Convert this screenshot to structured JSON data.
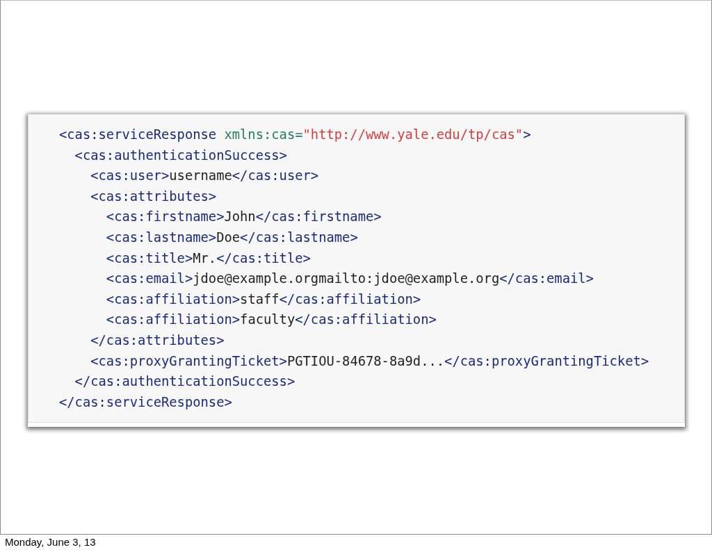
{
  "code_block": {
    "lines": [
      [
        {
          "kind": "tag",
          "text": "<cas:serviceResponse "
        },
        {
          "kind": "attr",
          "text": "xmlns:cas="
        },
        {
          "kind": "string",
          "text": "\"http://www.yale.edu/tp/cas\""
        },
        {
          "kind": "tag",
          "text": ">"
        }
      ],
      [
        {
          "kind": "tag",
          "text": "  <cas:authenticationSuccess>"
        }
      ],
      [
        {
          "kind": "tag",
          "text": "    <cas:user>"
        },
        {
          "kind": "text",
          "text": "username"
        },
        {
          "kind": "tag",
          "text": "</cas:user>"
        }
      ],
      [
        {
          "kind": "tag",
          "text": "    <cas:attributes>"
        }
      ],
      [
        {
          "kind": "tag",
          "text": "      <cas:firstname>"
        },
        {
          "kind": "text",
          "text": "John"
        },
        {
          "kind": "tag",
          "text": "</cas:firstname>"
        }
      ],
      [
        {
          "kind": "tag",
          "text": "      <cas:lastname>"
        },
        {
          "kind": "text",
          "text": "Doe"
        },
        {
          "kind": "tag",
          "text": "</cas:lastname>"
        }
      ],
      [
        {
          "kind": "tag",
          "text": "      <cas:title>"
        },
        {
          "kind": "text",
          "text": "Mr."
        },
        {
          "kind": "tag",
          "text": "</cas:title>"
        }
      ],
      [
        {
          "kind": "tag",
          "text": "      <cas:email>"
        },
        {
          "kind": "text",
          "text": "jdoe@example.orgmailto:jdoe@example.org"
        },
        {
          "kind": "tag",
          "text": "</cas:email>"
        }
      ],
      [
        {
          "kind": "tag",
          "text": "      <cas:affiliation>"
        },
        {
          "kind": "text",
          "text": "staff"
        },
        {
          "kind": "tag",
          "text": "</cas:affiliation>"
        }
      ],
      [
        {
          "kind": "tag",
          "text": "      <cas:affiliation>"
        },
        {
          "kind": "text",
          "text": "faculty"
        },
        {
          "kind": "tag",
          "text": "</cas:affiliation>"
        }
      ],
      [
        {
          "kind": "tag",
          "text": "    </cas:attributes>"
        }
      ],
      [
        {
          "kind": "tag",
          "text": "    <cas:proxyGrantingTicket>"
        },
        {
          "kind": "text",
          "text": "PGTIOU-84678-8a9d..."
        },
        {
          "kind": "tag",
          "text": "</cas:proxyGrantingTicket>"
        }
      ],
      [
        {
          "kind": "tag",
          "text": "  </cas:authenticationSuccess>"
        }
      ],
      [
        {
          "kind": "tag",
          "text": "</cas:serviceResponse>"
        }
      ]
    ]
  },
  "footer": {
    "date": "Monday, June 3, 13"
  }
}
